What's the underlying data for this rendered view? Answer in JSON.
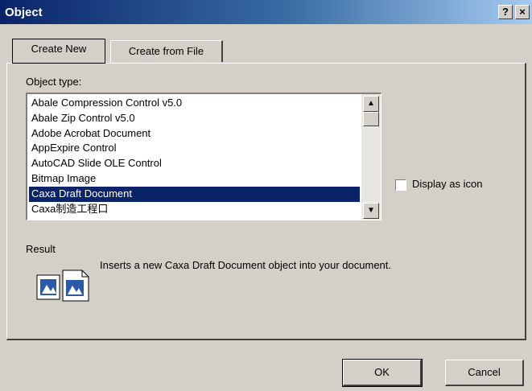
{
  "window": {
    "title": "Object",
    "help_glyph": "?",
    "close_glyph": "×"
  },
  "tabs": [
    {
      "label": "Create New",
      "active": true
    },
    {
      "label": "Create from File",
      "active": false
    }
  ],
  "object_type": {
    "label": "Object type:",
    "items": [
      {
        "label": "Abale Compression Control v5.0",
        "selected": false
      },
      {
        "label": "Abale Zip Control v5.0",
        "selected": false
      },
      {
        "label": "Adobe Acrobat Document",
        "selected": false
      },
      {
        "label": "AppExpire Control",
        "selected": false
      },
      {
        "label": "AutoCAD Slide OLE Control",
        "selected": false
      },
      {
        "label": "Bitmap Image",
        "selected": false
      },
      {
        "label": "Caxa Draft Document",
        "selected": true
      },
      {
        "label": "Caxa制造工程口",
        "selected": false
      }
    ]
  },
  "display_as_icon": {
    "label": "Display as icon",
    "checked": false
  },
  "result": {
    "label": "Result",
    "text": "Inserts a new Caxa Draft Document object into your document."
  },
  "buttons": {
    "ok": "OK",
    "cancel": "Cancel"
  },
  "icons": {
    "result": "document-pair-icon"
  },
  "colors": {
    "selection": "#0a246a",
    "titlebar_start": "#0a246a",
    "face": "#d4d0c8"
  }
}
